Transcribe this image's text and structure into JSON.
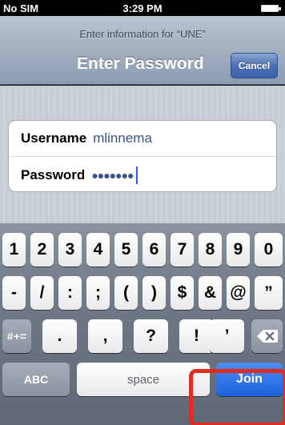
{
  "status_bar": {
    "carrier": "No SIM",
    "time": "3:29 PM",
    "battery_level": 1.0
  },
  "nav_bar": {
    "prompt": "Enter information for “UNE”",
    "title": "Enter Password",
    "cancel_label": "Cancel"
  },
  "form": {
    "username": {
      "label": "Username",
      "value": "mlinnema"
    },
    "password": {
      "label": "Password",
      "masked_value": "●●●●●●●"
    }
  },
  "keyboard": {
    "row1": [
      "1",
      "2",
      "3",
      "4",
      "5",
      "6",
      "7",
      "8",
      "9",
      "0"
    ],
    "row2": [
      "-",
      "/",
      ":",
      ";",
      "(",
      ")",
      "$",
      "&",
      "@",
      "”"
    ],
    "row3": {
      "shift_label": "#+=",
      "keys": [
        ".",
        ",",
        "?",
        "!",
        "’"
      ],
      "delete_icon": "delete-icon"
    },
    "row4": {
      "mode_label": "ABC",
      "space_label": "space",
      "join_label": "Join"
    }
  },
  "colors": {
    "nav_gradient_top": "#b9c4d1",
    "cancel_button": "#4b6fb3",
    "join_button": "#1b61df",
    "highlight": "#e32b21"
  }
}
